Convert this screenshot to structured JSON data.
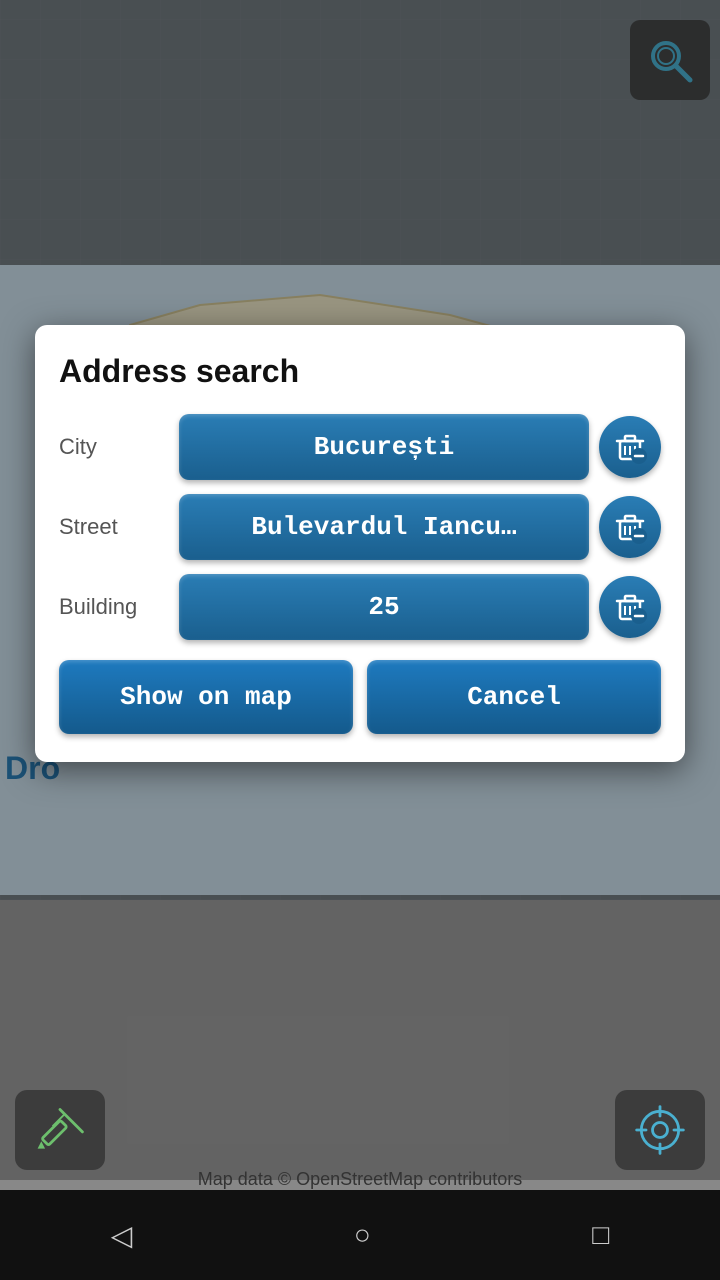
{
  "dialog": {
    "title": "Address search",
    "city_label": "City",
    "city_value": "București",
    "street_label": "Street",
    "street_value": "Bulevardul Iancu…",
    "building_label": "Building",
    "building_value": "25",
    "show_on_map_label": "Show on map",
    "cancel_label": "Cancel"
  },
  "map": {
    "attribution": "Map data © OpenStreetMap contributors",
    "dro_text": "Dro"
  },
  "nav": {
    "back_label": "◁",
    "home_label": "○",
    "recents_label": "□"
  },
  "icons": {
    "search": "search-icon",
    "trash": "trash-icon",
    "tools": "tools-icon",
    "gps": "gps-icon"
  }
}
